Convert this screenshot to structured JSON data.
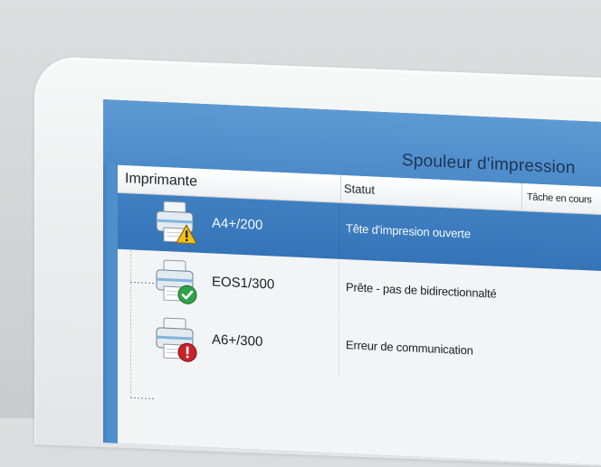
{
  "window": {
    "title": "Spouleur d'impression"
  },
  "columns": {
    "printer": "Imprimante",
    "status": "Statut",
    "job": "Tâche en cours"
  },
  "rows": [
    {
      "name": "A4+/200",
      "status": "Tête d'impresion ouverte",
      "badge": "warning-icon",
      "selected": true
    },
    {
      "name": "EOS1/300",
      "status": "Prête - pas de bidirectionnalté",
      "badge": "check-icon",
      "selected": false
    },
    {
      "name": "A6+/300",
      "status": "Erreur de communication",
      "badge": "error-icon",
      "selected": false
    }
  ],
  "colors": {
    "title_bar": "#4c8aca",
    "selection": "#3574b8",
    "warning": "#f2c21b",
    "ok": "#2fa34a",
    "error": "#c8232b"
  }
}
